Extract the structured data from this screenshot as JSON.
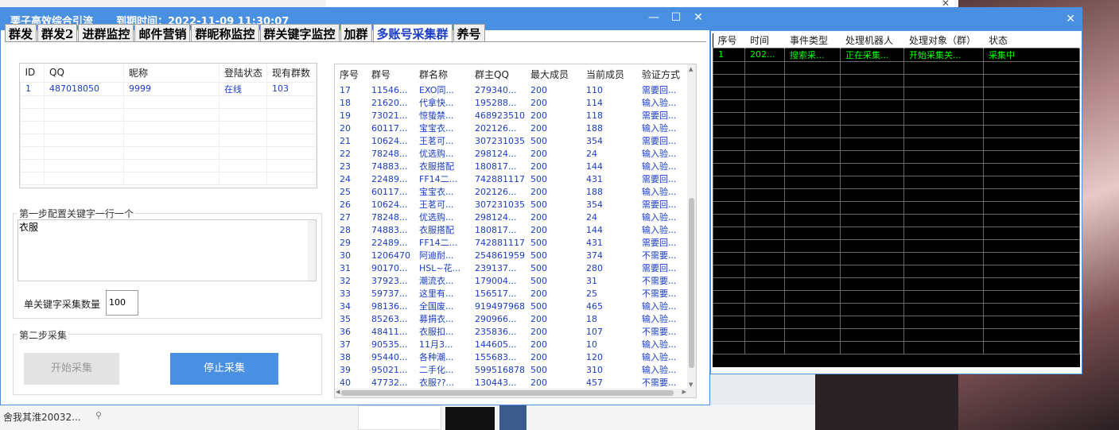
{
  "main_window": {
    "title": "栗子高效综合引流",
    "expiry": "到期时间：2022-11-09 11:30:07",
    "buttons": {
      "minimize": "—",
      "maximize": "☐",
      "close": "✕"
    }
  },
  "tabs": [
    "群发",
    "群发2",
    "进群监控",
    "邮件营销",
    "群昵称监控",
    "群关键字监控",
    "加群",
    "多账号采集群",
    "养号"
  ],
  "accounts": {
    "headers": [
      "ID",
      "QQ",
      "昵称",
      "登陆状态",
      "现有群数"
    ],
    "rows": [
      [
        "1",
        "487018050",
        "9999",
        "在线",
        "103"
      ]
    ]
  },
  "step1": {
    "legend": "第一步配置关键字一行一个",
    "keywords": "衣服",
    "count_label": "单关键字采集数量",
    "count_value": "100"
  },
  "step2": {
    "legend": "第二步采集",
    "start_button": "开始采集",
    "stop_button": "停止采集"
  },
  "groups": {
    "headers": [
      "序号",
      "群号",
      "群名称",
      "群主QQ",
      "最大成员",
      "当前成员",
      "验证方式"
    ],
    "rows": [
      [
        "17",
        "11546...",
        "EXO同...",
        "279340...",
        "200",
        "110",
        "需要回..."
      ],
      [
        "18",
        "21620...",
        "代拿快...",
        "195288...",
        "200",
        "114",
        "输入验..."
      ],
      [
        "19",
        "73021...",
        "惊蛰禁...",
        "468923510",
        "200",
        "118",
        "需要回..."
      ],
      [
        "20",
        "60117...",
        "宝宝衣...",
        "202126...",
        "200",
        "188",
        "输入验..."
      ],
      [
        "21",
        "10624...",
        "王茗可...",
        "307231035",
        "500",
        "354",
        "需要回..."
      ],
      [
        "22",
        "78248...",
        "优选购...",
        "298124...",
        "200",
        "24",
        "输入验..."
      ],
      [
        "23",
        "74883...",
        "衣服搭配",
        "180817...",
        "200",
        "144",
        "输入验..."
      ],
      [
        "24",
        "22489...",
        "FF14二...",
        "742881117",
        "500",
        "431",
        "需要回..."
      ],
      [
        "25",
        "60117...",
        "宝宝衣...",
        "202126...",
        "200",
        "188",
        "输入验..."
      ],
      [
        "26",
        "10624...",
        "王茗可...",
        "307231035",
        "500",
        "354",
        "需要回..."
      ],
      [
        "27",
        "78248...",
        "优选购...",
        "298124...",
        "200",
        "24",
        "输入验..."
      ],
      [
        "28",
        "74883...",
        "衣服搭配",
        "180817...",
        "200",
        "144",
        "输入验..."
      ],
      [
        "29",
        "22489...",
        "FF14二...",
        "742881117",
        "500",
        "431",
        "需要回..."
      ],
      [
        "30",
        "1206470",
        "阿迪耐...",
        "254861959",
        "500",
        "374",
        "不需要..."
      ],
      [
        "31",
        "90170...",
        "HSL~花...",
        "239137...",
        "500",
        "280",
        "需要回..."
      ],
      [
        "32",
        "37923...",
        "潮流衣...",
        "179004...",
        "500",
        "31",
        "不需要..."
      ],
      [
        "33",
        "59737...",
        "这里有...",
        "156517...",
        "200",
        "25",
        "不需要..."
      ],
      [
        "34",
        "98136...",
        "全国废...",
        "919497968",
        "500",
        "465",
        "输入验..."
      ],
      [
        "35",
        "85263...",
        "募捐衣...",
        "290966...",
        "200",
        "18",
        "输入验..."
      ],
      [
        "36",
        "48411...",
        "衣服扣...",
        "235836...",
        "200",
        "107",
        "不需要..."
      ],
      [
        "37",
        "90535...",
        "11月3...",
        "144605...",
        "200",
        "10",
        "输入验..."
      ],
      [
        "38",
        "95440...",
        "各种潮...",
        "155683...",
        "200",
        "120",
        "输入验..."
      ],
      [
        "39",
        "95021...",
        "二手化...",
        "599516878",
        "500",
        "310",
        "输入验..."
      ],
      [
        "40",
        "47732...",
        "衣服??...",
        "130443...",
        "200",
        "457",
        "不需要..."
      ]
    ]
  },
  "log_window": {
    "close": "✕",
    "headers": [
      "序号",
      "时间",
      "事件类型",
      "处理机器人",
      "处理对象（群）",
      "状态"
    ],
    "rows": [
      [
        "1",
        "202...",
        "搜索采...",
        "正在采集...",
        "开始采集关...",
        "采集中"
      ]
    ]
  },
  "background": {
    "taskbar_text": "舍我其淮20032...",
    "pin": "⚲",
    "behind_close": "✕"
  },
  "colors": {
    "accent": "#4a90e2",
    "link_blue": "#1a3cc6",
    "log_green": "#00ff00"
  }
}
